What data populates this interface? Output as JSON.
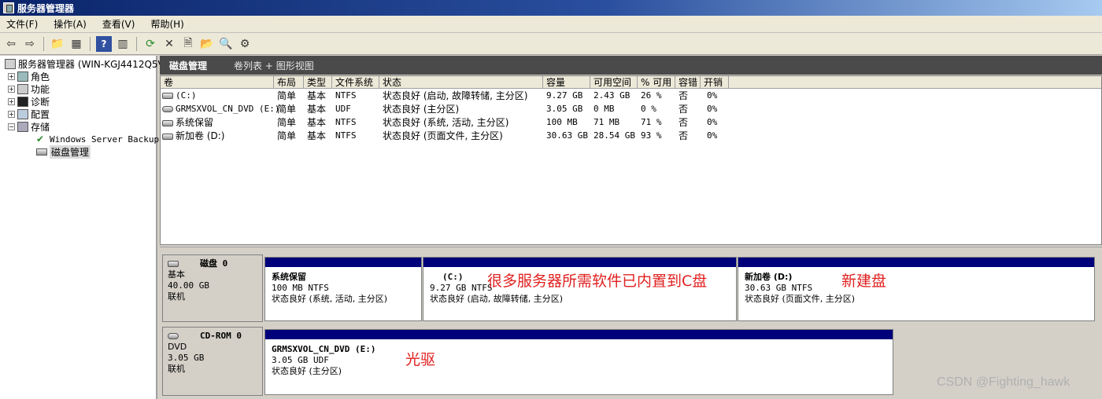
{
  "window": {
    "title": "服务器管理器"
  },
  "menu": [
    "文件(F)",
    "操作(A)",
    "查看(V)",
    "帮助(H)"
  ],
  "tree": {
    "root": "服务器管理器 (WIN-KGJ4412Q5V",
    "items": [
      "角色",
      "功能",
      "诊断",
      "配置",
      "存储"
    ],
    "storage_children": [
      "Windows Server Backup",
      "磁盘管理"
    ]
  },
  "pane": {
    "title": "磁盘管理",
    "views": "卷列表 + 图形视图"
  },
  "volume_table": {
    "columns": [
      "卷",
      "布局",
      "类型",
      "文件系统",
      "状态",
      "容量",
      "可用空间",
      "% 可用",
      "容错",
      "开销"
    ],
    "rows": [
      [
        "(C:)",
        "简单",
        "基本",
        "NTFS",
        "状态良好 (启动, 故障转储, 主分区)",
        "9.27 GB",
        "2.43 GB",
        "26 %",
        "否",
        "0%"
      ],
      [
        "GRMSXVOL_CN_DVD (E:)",
        "简单",
        "基本",
        "UDF",
        "状态良好 (主分区)",
        "3.05 GB",
        "0 MB",
        "0 %",
        "否",
        "0%"
      ],
      [
        "系统保留",
        "简单",
        "基本",
        "NTFS",
        "状态良好 (系统, 活动, 主分区)",
        "100 MB",
        "71 MB",
        "71 %",
        "否",
        "0%"
      ],
      [
        "新加卷 (D:)",
        "简单",
        "基本",
        "NTFS",
        "状态良好 (页面文件, 主分区)",
        "30.63 GB",
        "28.54 GB",
        "93 %",
        "否",
        "0%"
      ]
    ]
  },
  "disks": [
    {
      "name": "磁盘 0",
      "type": "基本",
      "size": "40.00 GB",
      "status": "联机",
      "partitions": [
        {
          "name": "系统保留",
          "info": "100 MB NTFS",
          "status": "状态良好 (系统, 活动, 主分区)"
        },
        {
          "name": "(C:)",
          "info": "9.27 GB NTFS",
          "status": "状态良好 (启动, 故障转储, 主分区)"
        },
        {
          "name": "新加卷 (D:)",
          "info": "30.63 GB NTFS",
          "status": "状态良好 (页面文件, 主分区)"
        }
      ]
    },
    {
      "name": "CD-ROM 0",
      "type": "DVD",
      "size": "3.05 GB",
      "status": "联机",
      "partitions": [
        {
          "name": "GRMSXVOL_CN_DVD (E:)",
          "info": "3.05 GB UDF",
          "status": "状态良好 (主分区)"
        }
      ]
    }
  ],
  "annotations": [
    "很多服务器所需软件已内置到C盘",
    "新建盘",
    "光驱"
  ],
  "watermark": "CSDN @Fighting_hawk"
}
